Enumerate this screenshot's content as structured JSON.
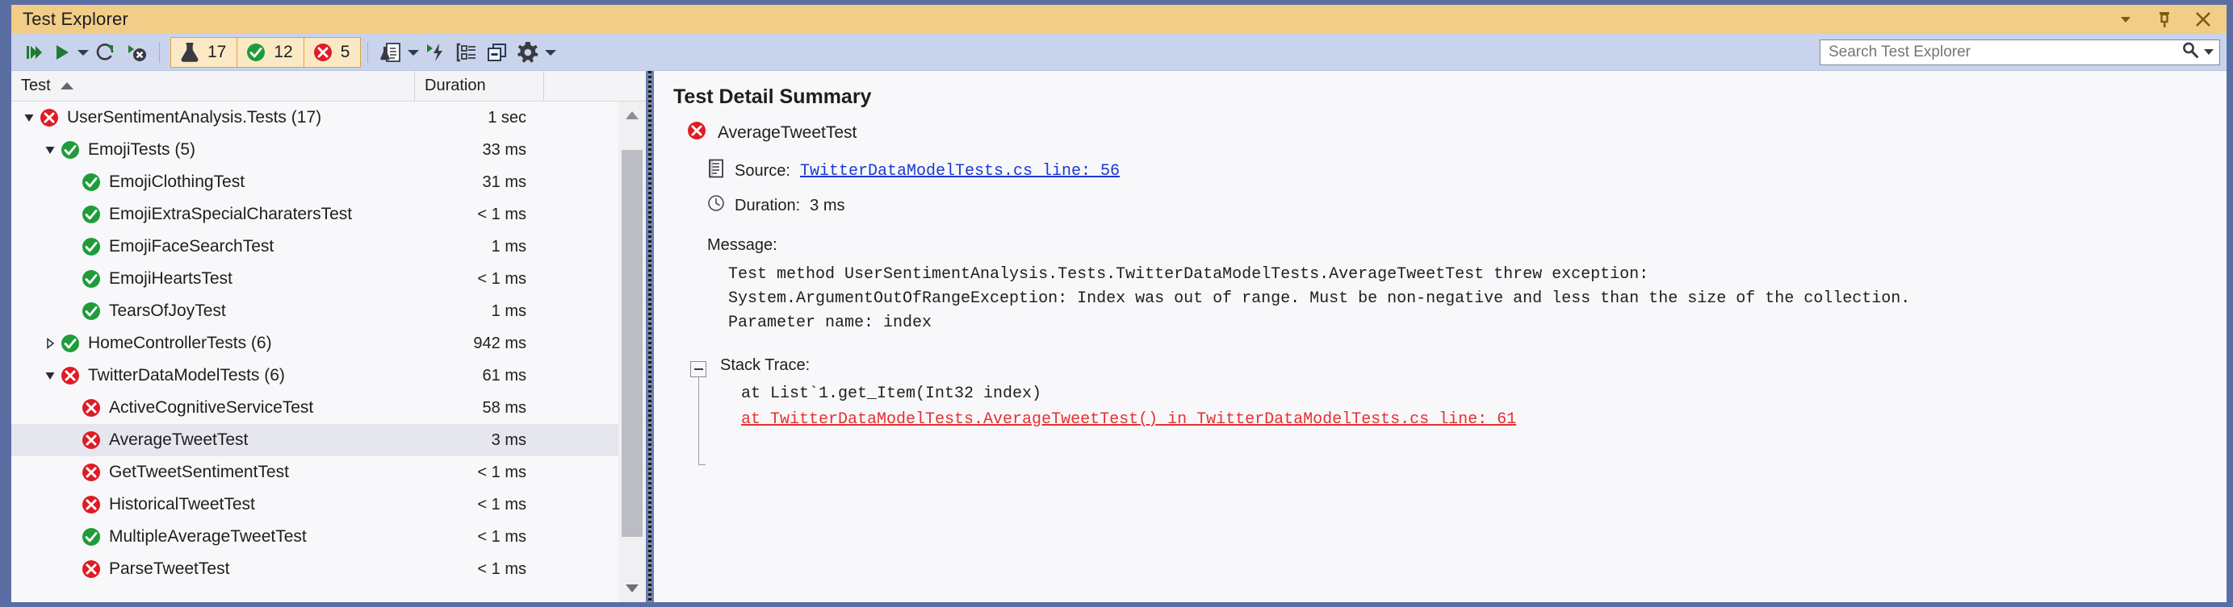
{
  "window": {
    "title": "Test Explorer",
    "title_buttons": [
      {
        "name": "dropdown",
        "glyph": "caret-down"
      },
      {
        "name": "pin",
        "glyph": "pin"
      },
      {
        "name": "close",
        "glyph": "close"
      }
    ],
    "colors": {
      "title_bar": "#f2cd88",
      "toolbar": "#c9d4ec",
      "window_border": "#5a6ea3",
      "pass_green": "#1f9c3a",
      "fail_red": "#e01b24",
      "link_blue": "#1a38d0",
      "link_red": "#e63030",
      "selection": "#e6e6ef"
    }
  },
  "toolbar": {
    "buttons": [
      {
        "label": "Run All Tests",
        "icon": "run-all-icon"
      },
      {
        "label": "Run",
        "icon": "run-icon"
      },
      {
        "label": "Run Dropdown",
        "icon": "chevron-down-icon"
      },
      {
        "label": "Repeat Last Run",
        "icon": "repeat-run-icon"
      },
      {
        "label": "Run Until Failure",
        "icon": "run-failed-icon"
      }
    ],
    "counters": [
      {
        "name": "total",
        "icon": "flask-icon",
        "count": "17"
      },
      {
        "name": "passed",
        "icon": "check-circle-icon",
        "count": "12"
      },
      {
        "name": "failed",
        "icon": "error-circle-icon",
        "count": "5"
      }
    ],
    "right_buttons": [
      {
        "label": "Test Settings",
        "icon": "flask-document-icon"
      },
      {
        "label": "Test Settings Dropdown",
        "icon": "chevron-down-icon"
      },
      {
        "label": "Analyze Impact",
        "icon": "run-lightning-icon"
      },
      {
        "label": "Group By",
        "icon": "group-by-icon"
      },
      {
        "label": "Show Test Hierarchy",
        "icon": "windows-icon"
      },
      {
        "label": "Options",
        "icon": "gear-icon"
      },
      {
        "label": "Options Dropdown",
        "icon": "chevron-down-icon"
      }
    ]
  },
  "search": {
    "placeholder": "Search Test Explorer",
    "value": "",
    "icon": "search-icon",
    "dropdown_icon": "chevron-down-icon"
  },
  "grid": {
    "columns": [
      {
        "key": "test",
        "label": "Test",
        "sort": "ascending"
      },
      {
        "key": "duration",
        "label": "Duration"
      },
      {
        "key": "extra",
        "label": ""
      }
    ],
    "rows": [
      {
        "name": "UserSentimentAnalysis.Tests (17)",
        "duration": "1 sec",
        "status": "failed",
        "level": 0,
        "twisty": "expanded",
        "selected": false
      },
      {
        "name": "EmojiTests (5)",
        "duration": "33 ms",
        "status": "passed",
        "level": 1,
        "twisty": "expanded",
        "selected": false
      },
      {
        "name": "EmojiClothingTest",
        "duration": "31 ms",
        "status": "passed",
        "level": 2,
        "twisty": "none",
        "selected": false
      },
      {
        "name": "EmojiExtraSpecialCharatersTest",
        "duration": "< 1 ms",
        "status": "passed",
        "level": 2,
        "twisty": "none",
        "selected": false
      },
      {
        "name": "EmojiFaceSearchTest",
        "duration": "1 ms",
        "status": "passed",
        "level": 2,
        "twisty": "none",
        "selected": false
      },
      {
        "name": "EmojiHeartsTest",
        "duration": "< 1 ms",
        "status": "passed",
        "level": 2,
        "twisty": "none",
        "selected": false
      },
      {
        "name": "TearsOfJoyTest",
        "duration": "1 ms",
        "status": "passed",
        "level": 2,
        "twisty": "none",
        "selected": false
      },
      {
        "name": "HomeControllerTests (6)",
        "duration": "942 ms",
        "status": "passed",
        "level": 1,
        "twisty": "collapsed",
        "selected": false
      },
      {
        "name": "TwitterDataModelTests (6)",
        "duration": "61 ms",
        "status": "failed",
        "level": 1,
        "twisty": "expanded",
        "selected": false
      },
      {
        "name": "ActiveCognitiveServiceTest",
        "duration": "58 ms",
        "status": "failed",
        "level": 2,
        "twisty": "none",
        "selected": false
      },
      {
        "name": "AverageTweetTest",
        "duration": "3 ms",
        "status": "failed",
        "level": 2,
        "twisty": "none",
        "selected": true
      },
      {
        "name": "GetTweetSentimentTest",
        "duration": "< 1 ms",
        "status": "failed",
        "level": 2,
        "twisty": "none",
        "selected": false
      },
      {
        "name": "HistoricalTweetTest",
        "duration": "< 1 ms",
        "status": "failed",
        "level": 2,
        "twisty": "none",
        "selected": false
      },
      {
        "name": "MultipleAverageTweetTest",
        "duration": "< 1 ms",
        "status": "passed",
        "level": 2,
        "twisty": "none",
        "selected": false
      },
      {
        "name": "ParseTweetTest",
        "duration": "< 1 ms",
        "status": "failed",
        "level": 2,
        "twisty": "none",
        "selected": false
      }
    ]
  },
  "detail": {
    "title": "Test Detail Summary",
    "test_name": "AverageTweetTest",
    "test_status": "failed",
    "source_label": "Source:",
    "source_icon": "source-file-icon",
    "source_link": "TwitterDataModelTests.cs line: 56",
    "duration_label": "Duration:",
    "duration_icon": "clock-icon",
    "duration_value": "3 ms",
    "message_label": "Message:",
    "message_lines": [
      "Test method UserSentimentAnalysis.Tests.TwitterDataModelTests.AverageTweetTest threw exception:",
      "System.ArgumentOutOfRangeException: Index was out of range. Must be non-negative and less than the size of the collection.",
      "Parameter name: index"
    ],
    "stack_label": "Stack Trace:",
    "stack_lines": [
      {
        "text": "at List`1.get_Item(Int32 index)",
        "link": false
      },
      {
        "text": "at TwitterDataModelTests.AverageTweetTest() in TwitterDataModelTests.cs line: 61",
        "link": true
      }
    ]
  }
}
